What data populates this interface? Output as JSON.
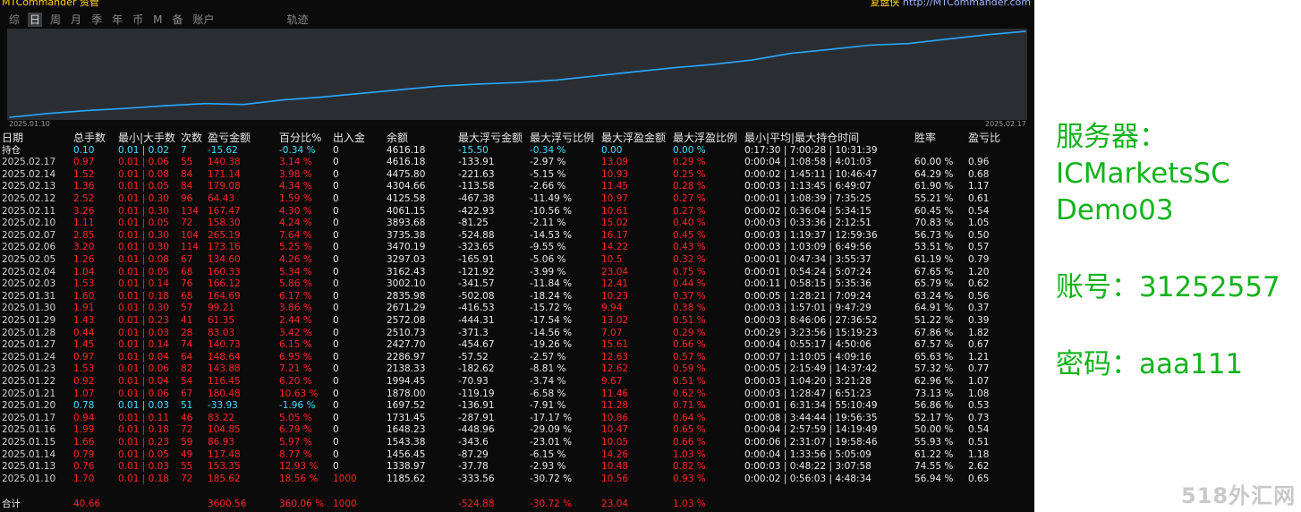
{
  "app": {
    "brand": "MTCommander 资管",
    "site_label": "复盘侠",
    "site_url": "http://MTCommander.com"
  },
  "tabs": [
    {
      "label": "综",
      "active": false
    },
    {
      "label": "日",
      "active": true
    },
    {
      "label": "周",
      "active": false
    },
    {
      "label": "月",
      "active": false
    },
    {
      "label": "季",
      "active": false
    },
    {
      "label": "年",
      "active": false
    },
    {
      "label": "币",
      "active": false
    },
    {
      "label": "M",
      "active": false
    },
    {
      "label": "备",
      "active": false
    },
    {
      "label": "账户",
      "active": false
    },
    {
      "label": "轨迹",
      "active": false
    }
  ],
  "chart_data": {
    "type": "line",
    "x_start_label": "2025.01.10",
    "x_end_label": "2025.02.17",
    "line_color": "#29a8ff",
    "background": "#2a2e33",
    "grid": false,
    "x": [
      "2025.01.10",
      "2025.01.13",
      "2025.01.14",
      "2025.01.15",
      "2025.01.16",
      "2025.01.17",
      "2025.01.20",
      "2025.01.21",
      "2025.01.22",
      "2025.01.23",
      "2025.01.24",
      "2025.01.27",
      "2025.01.28",
      "2025.01.29",
      "2025.01.30",
      "2025.01.31",
      "2025.02.03",
      "2025.02.04",
      "2025.02.05",
      "2025.02.06",
      "2025.02.07",
      "2025.02.10",
      "2025.02.11",
      "2025.02.12",
      "2025.02.13",
      "2025.02.14",
      "2025.02.17"
    ],
    "y": [
      1185.62,
      1338.97,
      1456.45,
      1543.38,
      1648.23,
      1731.45,
      1697.52,
      1878.0,
      1994.45,
      2138.33,
      2286.97,
      2427.7,
      2510.73,
      2572.08,
      2671.29,
      2835.98,
      3002.1,
      3162.43,
      3297.03,
      3470.19,
      3735.38,
      3893.68,
      4061.15,
      4125.58,
      4304.66,
      4475.8,
      4616.18
    ]
  },
  "table": {
    "headers": [
      "日期",
      "总手数",
      "最小|大手数",
      "次数",
      "盈亏金额",
      "百分比%",
      "出入金",
      "余额",
      "最大浮亏金额",
      "最大浮亏比例",
      "最大浮盈金额",
      "最大浮盈比例",
      "最小|平均|最大持仓时间",
      "胜率",
      "盈亏比"
    ],
    "holding": [
      "持仓",
      "0.10",
      "0.01 | 0.02",
      "7",
      "-15.62",
      "-0.34 %",
      "0",
      "4616.18",
      "-15.50",
      "-0.34 %",
      "0.00",
      "0.00 %",
      "0:17:30 | 7:00:28 | 10:31:39",
      "",
      ""
    ],
    "rows": [
      [
        "2025.02.17",
        "0.97",
        "0.01 | 0.06",
        "55",
        "140.38",
        "3.14 %",
        "0",
        "4616.18",
        "-133.91",
        "-2.97 %",
        "13.09",
        "0.29 %",
        "0:00:04 | 1:08:58 | 4:01:03",
        "60.00 %",
        "0.96"
      ],
      [
        "2025.02.14",
        "1.52",
        "0.01 | 0.08",
        "84",
        "171.14",
        "3.98 %",
        "0",
        "4475.80",
        "-221.63",
        "-5.15 %",
        "10.93",
        "0.25 %",
        "0:00:02 | 1:45:11 | 10:46:47",
        "64.29 %",
        "0.68"
      ],
      [
        "2025.02.13",
        "1.36",
        "0.01 | 0.05",
        "84",
        "179.08",
        "4.34 %",
        "0",
        "4304.66",
        "-113.58",
        "-2.66 %",
        "11.45",
        "0.28 %",
        "0:00:03 | 1:13:45 | 6:49:07",
        "61.90 %",
        "1.17"
      ],
      [
        "2025.02.12",
        "2.52",
        "0.01 | 0.30",
        "96",
        "64.43",
        "1.59 %",
        "0",
        "4125.58",
        "-467.38",
        "-11.49 %",
        "10.97",
        "0.27 %",
        "0:00:01 | 1:08:39 | 7:35:25",
        "55.21 %",
        "0.61"
      ],
      [
        "2025.02.11",
        "3.26",
        "0.01 | 0.30",
        "134",
        "167.47",
        "4.30 %",
        "0",
        "4061.15",
        "-422.93",
        "-10.56 %",
        "10.61",
        "0.27 %",
        "0:00:02 | 0:36:04 | 5:34:15",
        "60.45 %",
        "0.54"
      ],
      [
        "2025.02.10",
        "1.11",
        "0.01 | 0.05",
        "72",
        "158.30",
        "4.24 %",
        "0",
        "3893.68",
        "-81.25",
        "-2.11 %",
        "15.02",
        "0.40 %",
        "0:00:03 | 0:33:36 | 2:12:51",
        "70.83 %",
        "1.05"
      ],
      [
        "2025.02.07",
        "2.85",
        "0.01 | 0.30",
        "104",
        "265.19",
        "7.64 %",
        "0",
        "3735.38",
        "-524.88",
        "-14.53 %",
        "16.17",
        "0.45 %",
        "0:00:03 | 1:19:37 | 12:59:36",
        "56.73 %",
        "0.50"
      ],
      [
        "2025.02.06",
        "3.20",
        "0.01 | 0.30",
        "114",
        "173.16",
        "5.25 %",
        "0",
        "3470.19",
        "-323.65",
        "-9.55 %",
        "14.22",
        "0.43 %",
        "0:00:03 | 1:03:09 | 6:49:56",
        "53.51 %",
        "0.57"
      ],
      [
        "2025.02.05",
        "1.26",
        "0.01 | 0.08",
        "67",
        "134.60",
        "4.26 %",
        "0",
        "3297.03",
        "-165.91",
        "-5.06 %",
        "10.5",
        "0.32 %",
        "0:00:01 | 0:47:34 | 3:55:37",
        "61.19 %",
        "0.79"
      ],
      [
        "2025.02.04",
        "1.04",
        "0.01 | 0.05",
        "68",
        "160.33",
        "5.34 %",
        "0",
        "3162.43",
        "-121.92",
        "-3.99 %",
        "23.04",
        "0.75 %",
        "0:00:01 | 0:54:24 | 5:07:24",
        "67.65 %",
        "1.20"
      ],
      [
        "2025.02.03",
        "1.53",
        "0.01 | 0.14",
        "76",
        "166.12",
        "5.86 %",
        "0",
        "3002.10",
        "-341.57",
        "-11.84 %",
        "12.41",
        "0.44 %",
        "0:00:11 | 0:58:15 | 5:35:36",
        "65.79 %",
        "0.62"
      ],
      [
        "2025.01.31",
        "1.60",
        "0.01 | 0.18",
        "68",
        "164.69",
        "6.17 %",
        "0",
        "2835.98",
        "-502.08",
        "-18.24 %",
        "10.23",
        "0.37 %",
        "0:00:05 | 1:28:21 | 7:09:24",
        "63.24 %",
        "0.56"
      ],
      [
        "2025.01.30",
        "1.91",
        "0.01 | 0.30",
        "57",
        "99.21",
        "3.86 %",
        "0",
        "2671.29",
        "-416.53",
        "-15.72 %",
        "9.94",
        "0.38 %",
        "0:00:03 | 1:57:01 | 9:47:29",
        "64.91 %",
        "0.37"
      ],
      [
        "2025.01.29",
        "1.43",
        "0.01 | 0.23",
        "41",
        "61.35",
        "2.44 %",
        "0",
        "2572.08",
        "-444.31",
        "-17.54 %",
        "13.02",
        "0.51 %",
        "0:00:03 | 8:46:06 | 27:36:52",
        "51.22 %",
        "0.39"
      ],
      [
        "2025.01.28",
        "0.44",
        "0.01 | 0.03",
        "28",
        "83.03",
        "3.42 %",
        "0",
        "2510.73",
        "-371.3",
        "-14.56 %",
        "7.07",
        "0.29 %",
        "0:00:29 | 3:23:56 | 15:19:23",
        "67.86 %",
        "1.82"
      ],
      [
        "2025.01.27",
        "1.45",
        "0.01 | 0.14",
        "74",
        "140.73",
        "6.15 %",
        "0",
        "2427.70",
        "-454.67",
        "-19.26 %",
        "15.61",
        "0.66 %",
        "0:00:04 | 0:55:17 | 4:50:06",
        "67.57 %",
        "0.67"
      ],
      [
        "2025.01.24",
        "0.97",
        "0.01 | 0.04",
        "64",
        "148.64",
        "6.95 %",
        "0",
        "2286.97",
        "-57.52",
        "-2.57 %",
        "12.63",
        "0.57 %",
        "0:00:07 | 1:10:05 | 4:09:16",
        "65.63 %",
        "1.21"
      ],
      [
        "2025.01.23",
        "1.53",
        "0.01 | 0.06",
        "82",
        "143.88",
        "7.21 %",
        "0",
        "2138.33",
        "-182.62",
        "-8.81 %",
        "12.62",
        "0.59 %",
        "0:00:05 | 2:15:49 | 14:37:42",
        "57.32 %",
        "0.77"
      ],
      [
        "2025.01.22",
        "0.92",
        "0.01 | 0.04",
        "54",
        "116.45",
        "6.20 %",
        "0",
        "1994.45",
        "-70.93",
        "-3.74 %",
        "9.67",
        "0.51 %",
        "0:00:03 | 1:04:20 | 3:21:28",
        "62.96 %",
        "1.07"
      ],
      [
        "2025.01.21",
        "1.07",
        "0.01 | 0.06",
        "67",
        "180.48",
        "10.63 %",
        "0",
        "1878.00",
        "-119.19",
        "-6.58 %",
        "11.46",
        "0.62 %",
        "0:00:03 | 1:28:47 | 6:51:23",
        "73.13 %",
        "1.08"
      ],
      [
        "2025.01.20",
        "0.78",
        "0.01 | 0.03",
        "51",
        "-33.93",
        "-1.96 %",
        "0",
        "1697.52",
        "-136.91",
        "-7.91 %",
        "11.28",
        "0.71 %",
        "0:00:01 | 6:31:34 | 55:10:49",
        "56.86 %",
        "0.53"
      ],
      [
        "2025.01.17",
        "0.94",
        "0.01 | 0.11",
        "46",
        "83.22",
        "5.05 %",
        "0",
        "1731.45",
        "-287.91",
        "-17.17 %",
        "10.86",
        "0.64 %",
        "0:00:08 | 3:44:44 | 19:56:35",
        "52.17 %",
        "0.73"
      ],
      [
        "2025.01.16",
        "1.99",
        "0.01 | 0.18",
        "72",
        "104.85",
        "6.79 %",
        "0",
        "1648.23",
        "-448.96",
        "-29.09 %",
        "10.47",
        "0.65 %",
        "0:00:04 | 2:57:59 | 14:19:49",
        "50.00 %",
        "0.54"
      ],
      [
        "2025.01.15",
        "1.66",
        "0.01 | 0.23",
        "59",
        "86.93",
        "5.97 %",
        "0",
        "1543.38",
        "-343.6",
        "-23.01 %",
        "10.05",
        "0.66 %",
        "0:00:06 | 2:31:07 | 19:58:46",
        "55.93 %",
        "0.51"
      ],
      [
        "2025.01.14",
        "0.79",
        "0.01 | 0.05",
        "49",
        "117.48",
        "8.77 %",
        "0",
        "1456.45",
        "-87.29",
        "-6.15 %",
        "14.26",
        "1.03 %",
        "0:00:04 | 1:33:56 | 5:05:09",
        "61.22 %",
        "1.18"
      ],
      [
        "2025.01.13",
        "0.76",
        "0.01 | 0.03",
        "55",
        "153.35",
        "12.93 %",
        "0",
        "1338.97",
        "-37.78",
        "-2.93 %",
        "10.48",
        "0.82 %",
        "0:00:03 | 0:48:22 | 3:07:58",
        "74.55 %",
        "2.62"
      ],
      [
        "2025.01.10",
        "1.70",
        "0.01 | 0.18",
        "72",
        "185.62",
        "18.56 %",
        "1000",
        "1185.62",
        "-333.56",
        "-30.72 %",
        "10.56",
        "0.93 %",
        "0:00:02 | 0:56:03 | 4:48:34",
        "56.94 %",
        "0.65"
      ]
    ],
    "total": [
      "合计",
      "40.66",
      "",
      "",
      "3600.56",
      "360.06 %",
      "1000",
      "",
      "-524.88",
      "-30.72 %",
      "23.04",
      "1.03 %",
      "",
      "",
      ""
    ]
  },
  "info": {
    "server_label": "服务器：",
    "server_name": "ICMarketsSC",
    "server_suffix": "Demo03",
    "account_line": "账号：31252557",
    "password_line": "密码：aaa111"
  },
  "watermark": "518外汇网",
  "colors": {
    "negative": "#ff2424",
    "positive": "#43e0ff",
    "header": "#e6e6e6",
    "side_text": "#12b31c"
  }
}
